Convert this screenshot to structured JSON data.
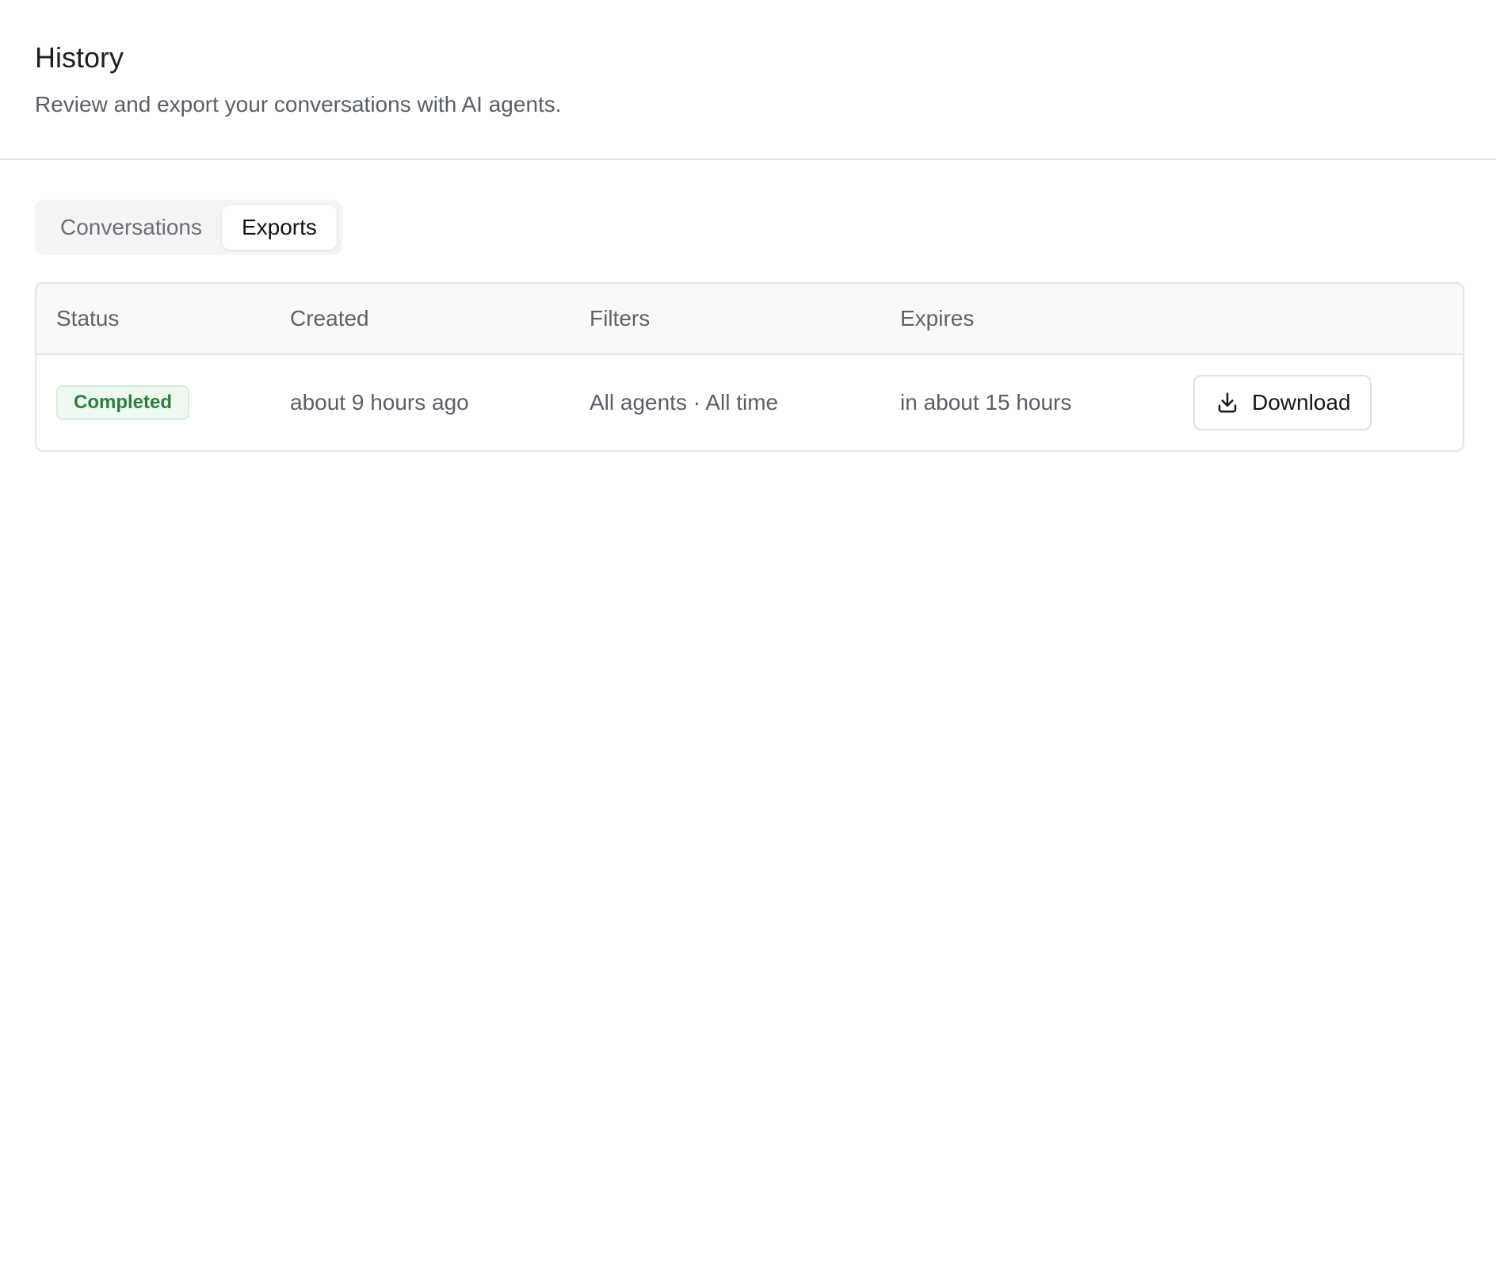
{
  "header": {
    "title": "History",
    "subtitle": "Review and export your conversations with AI agents."
  },
  "tabs": [
    {
      "label": "Conversations",
      "active": false
    },
    {
      "label": "Exports",
      "active": true
    }
  ],
  "table": {
    "columns": [
      "Status",
      "Created",
      "Filters",
      "Expires"
    ],
    "rows": [
      {
        "status": "Completed",
        "created": "about 9 hours ago",
        "filters": "All agents · All time",
        "expires": "in about 15 hours",
        "action_label": "Download",
        "action_icon": "download-icon"
      }
    ]
  },
  "colors": {
    "status_completed_text": "#2e7d3f",
    "status_completed_bg": "#eef8f0"
  }
}
